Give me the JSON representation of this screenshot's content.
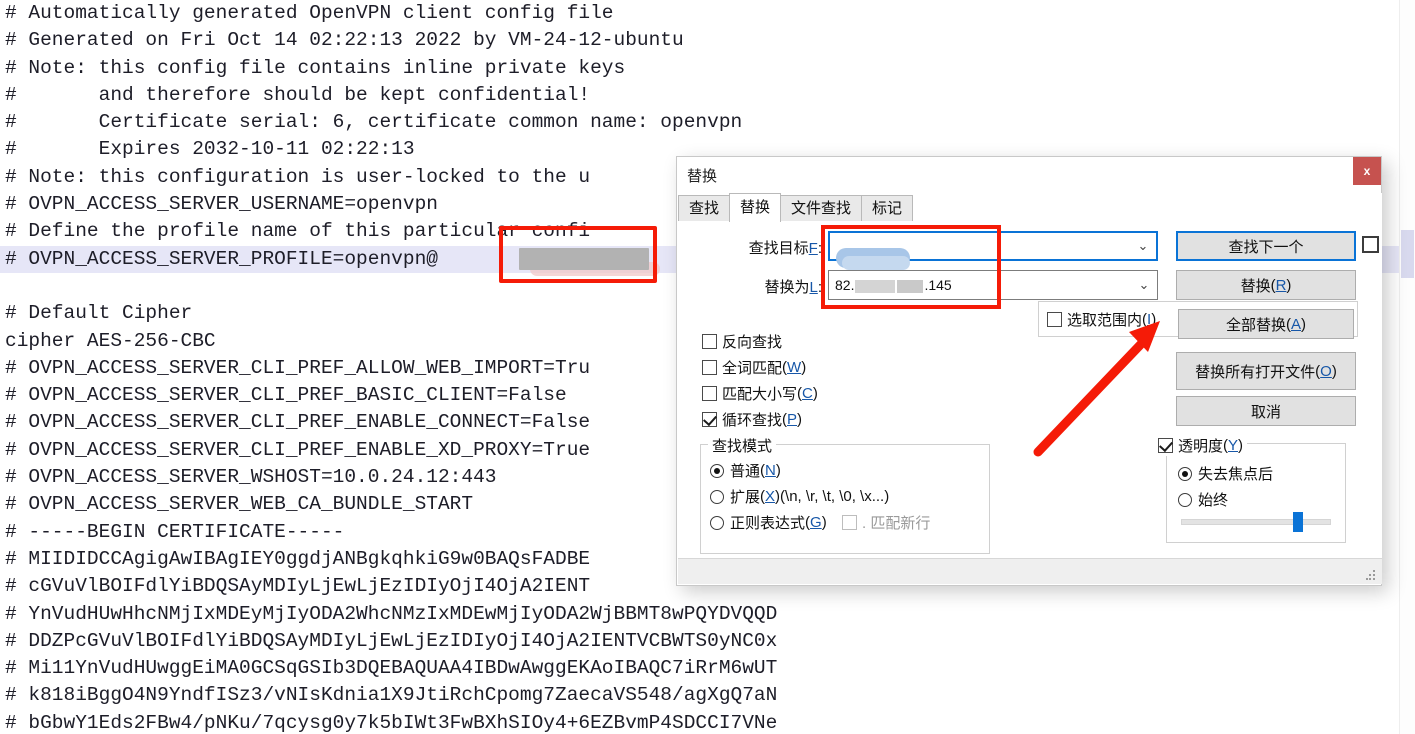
{
  "editor": {
    "lines": [
      {
        "text": "# Automatically generated OpenVPN client config file",
        "highlight": false
      },
      {
        "text": "# Generated on Fri Oct 14 02:22:13 2022 by VM-24-12-ubuntu",
        "highlight": false
      },
      {
        "text": "# Note: this config file contains inline private keys",
        "highlight": false
      },
      {
        "text": "#       and therefore should be kept confidential!",
        "highlight": false
      },
      {
        "text": "#       Certificate serial: 6, certificate common name: openvpn",
        "highlight": false
      },
      {
        "text": "#       Expires 2032-10-11 02:22:13",
        "highlight": false
      },
      {
        "text": "# Note: this configuration is user-locked to the u",
        "highlight": false
      },
      {
        "text": "# OVPN_ACCESS_SERVER_USERNAME=openvpn",
        "highlight": false
      },
      {
        "text": "# Define the profile name of this particular confi",
        "highlight": false
      },
      {
        "text": "# OVPN_ACCESS_SERVER_PROFILE=openvpn@",
        "highlight": true
      },
      {
        "text": "",
        "highlight": false
      },
      {
        "text": "# Default Cipher",
        "highlight": false
      },
      {
        "text": "cipher AES-256-CBC",
        "highlight": false
      },
      {
        "text": "# OVPN_ACCESS_SERVER_CLI_PREF_ALLOW_WEB_IMPORT=Tru",
        "highlight": false
      },
      {
        "text": "# OVPN_ACCESS_SERVER_CLI_PREF_BASIC_CLIENT=False",
        "highlight": false
      },
      {
        "text": "# OVPN_ACCESS_SERVER_CLI_PREF_ENABLE_CONNECT=False",
        "highlight": false
      },
      {
        "text": "# OVPN_ACCESS_SERVER_CLI_PREF_ENABLE_XD_PROXY=True",
        "highlight": false
      },
      {
        "text": "# OVPN_ACCESS_SERVER_WSHOST=10.0.24.12:443",
        "highlight": false
      },
      {
        "text": "# OVPN_ACCESS_SERVER_WEB_CA_BUNDLE_START",
        "highlight": false
      },
      {
        "text": "# -----BEGIN CERTIFICATE-----",
        "highlight": false
      },
      {
        "text": "# MIIDIDCCAgigAwIBAgIEY0ggdjANBgkqhkiG9w0BAQsFADBE",
        "highlight": false
      },
      {
        "text": "# cGVuVlBOIFdlYiBDQSAyMDIyLjEwLjEzIDIyOjI4OjA2IENT",
        "highlight": false
      },
      {
        "text": "# YnVudHUwHhcNMjIxMDEyMjIyODA2WhcNMzIxMDEwMjIyODA2WjBBMT8wPQYDVQQD",
        "highlight": false
      },
      {
        "text": "# DDZPcGVuVlBOIFdlYiBDQSAyMDIyLjEwLjEzIDIyOjI4OjA2IENTVCBWTS0yNC0x",
        "highlight": false
      },
      {
        "text": "# Mi11YnVudHUwggEiMA0GCSqGSIb3DQEBAQUAA4IBDwAwggEKAoIBAQC7iRrM6wUT",
        "highlight": false
      },
      {
        "text": "# k818iBggO4N9YndfISz3/vNIsKdnia1X9JtiRchCpomg7ZaecaVS548/agXgQ7aN",
        "highlight": false
      },
      {
        "text": "# bGbwY1Eds2FBw4/pNKu/7qcysg0y7k5bIWt3FwBXhSIOy4+6EZBvmP4SDCCI7VNe",
        "highlight": false
      }
    ],
    "redacted_value": "",
    "scrollbar": "vertical-scrollbar"
  },
  "dialog": {
    "title": "替换",
    "close_label": "x",
    "tabs": [
      {
        "label": "查找",
        "active": false
      },
      {
        "label": "替换",
        "active": true
      },
      {
        "label": "文件查找",
        "active": false
      },
      {
        "label": "标记",
        "active": false
      }
    ],
    "fields": {
      "find": {
        "label": "查找目标(F)",
        "label_text": "查找目标",
        "accesskey": "F",
        "value": "",
        "caret": "⌄"
      },
      "replace": {
        "label": "替换为(L)",
        "label_text": "替换为",
        "accesskey": "L",
        "value_prefix": "82.",
        "value_suffix": ".145",
        "caret": "⌄"
      }
    },
    "buttons": {
      "find_next": "查找下一个",
      "replace": "替换",
      "replace_accesskey": "R",
      "replace_all": "全部替换",
      "replace_all_accesskey": "A",
      "replace_all_open_files": "替换所有打开文件",
      "replace_all_open_files_accesskey": "O",
      "cancel": "取消"
    },
    "checkboxes": [
      {
        "label": "反向查找",
        "accesskey": "",
        "checked": false
      },
      {
        "label": "全词匹配",
        "accesskey": "W",
        "checked": false
      },
      {
        "label": "匹配大小写",
        "accesskey": "C",
        "checked": false
      },
      {
        "label": "循环查找",
        "accesskey": "P",
        "checked": true
      }
    ],
    "in_selection": {
      "label": "选取范围内",
      "accesskey": "I",
      "checked": false
    },
    "search_mode": {
      "legend": "查找模式",
      "options": [
        {
          "label": "普通",
          "accesskey": "N",
          "suffix": "",
          "selected": true
        },
        {
          "label": "扩展",
          "accesskey": "X",
          "suffix": " (\\n, \\r, \\t, \\0, \\x...)",
          "selected": false
        },
        {
          "label": "正则表达式",
          "accesskey": "G",
          "suffix": "",
          "selected": false
        }
      ],
      "match_newline": {
        "label": ". 匹配新行",
        "checked": false,
        "enabled": false
      }
    },
    "transparency": {
      "label": "透明度",
      "accesskey": "Y",
      "checked": true,
      "options": [
        {
          "label": "失去焦点后",
          "selected": true
        },
        {
          "label": "始终",
          "selected": false
        }
      ],
      "slider_percent": 80
    }
  },
  "annotations": {
    "rect_color": "#f51b07",
    "arrow_color": "#f51b07",
    "code_rect": "red-highlight-rectangle-over-profile-value",
    "combo_rect": "red-highlight-rectangle-over-find-replace-fields",
    "arrow": "red-arrow-pointing-to-replace-all"
  }
}
